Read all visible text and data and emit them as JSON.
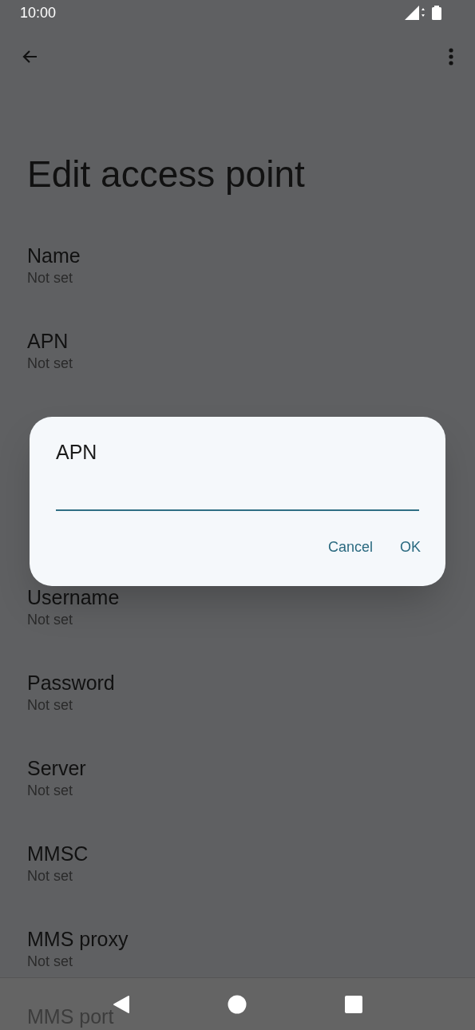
{
  "status_bar": {
    "time": "10:00"
  },
  "title": "Edit access point",
  "fields": [
    {
      "kind": "field",
      "label": "Name",
      "value": "Not set"
    },
    {
      "kind": "field",
      "label": "APN",
      "value": "Not set"
    },
    {
      "kind": "covered"
    },
    {
      "kind": "covered"
    },
    {
      "kind": "field",
      "label": "Username",
      "value": "Not set"
    },
    {
      "kind": "field",
      "label": "Password",
      "value": "Not set"
    },
    {
      "kind": "field",
      "label": "Server",
      "value": "Not set"
    },
    {
      "kind": "field",
      "label": "MMSC",
      "value": "Not set"
    },
    {
      "kind": "field",
      "label": "MMS proxy",
      "value": "Not set"
    },
    {
      "kind": "field",
      "label": "MMS port"
    }
  ],
  "dialog": {
    "title": "APN",
    "buttons": [
      "Cancel",
      "OK"
    ]
  }
}
